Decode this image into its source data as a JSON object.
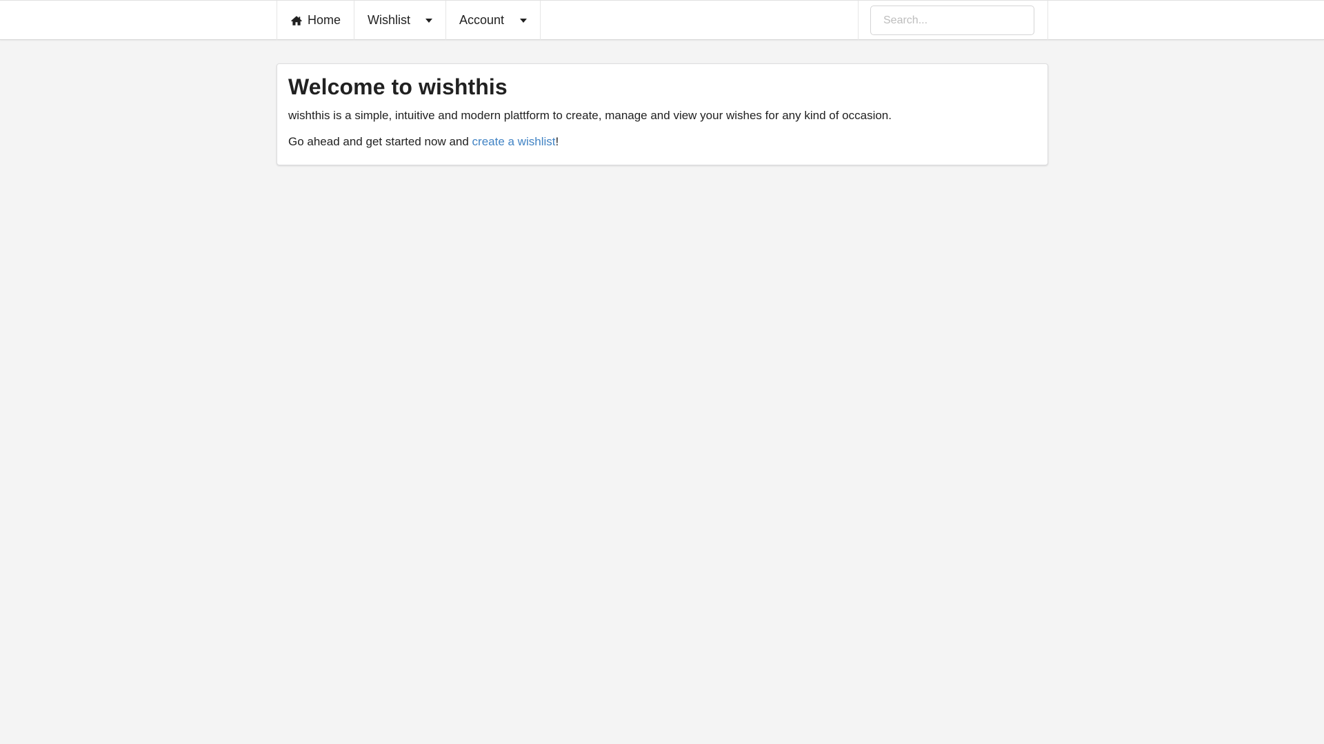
{
  "nav": {
    "home_label": "Home",
    "home_icon": "home-icon",
    "wishlist_label": "Wishlist",
    "account_label": "Account",
    "dropdown_icon": "dropdown-caret-icon"
  },
  "search": {
    "placeholder": "Search...",
    "value": ""
  },
  "welcome": {
    "title": "Welcome to wishthis",
    "intro": "wishthis is a simple, intuitive and modern plattform to create, manage and view your wishes for any kind of occasion.",
    "cta_prefix": "Go ahead and get started now and ",
    "cta_link": "create a wishlist",
    "cta_suffix": "!"
  },
  "colors": {
    "link": "#4183c4",
    "background": "#f4f4f4",
    "text": "#212121"
  }
}
